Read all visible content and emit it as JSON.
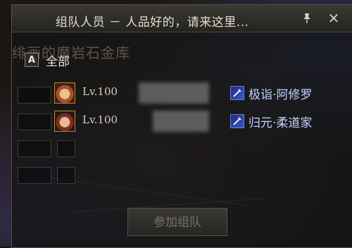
{
  "window": {
    "title": "组队人员 － 人品好的，请来这里..."
  },
  "background_text": "绯画的魔岩石金库",
  "filter": {
    "label": "全部",
    "icon_glyph": "A"
  },
  "members": [
    {
      "level": "Lv.100",
      "class_name": "极诣·阿修罗",
      "avatar_icon": "character-portrait-icon"
    },
    {
      "level": "Lv.100",
      "class_name": "归元·柔道家",
      "avatar_icon": "character-portrait-icon"
    }
  ],
  "join_button": {
    "label": "参加组队",
    "enabled": false
  },
  "icons": {
    "pin": "pin-icon",
    "close": "close-icon",
    "class": "sword-icon"
  },
  "colors": {
    "class_text": "#c5d2ff",
    "accent_border": "#b48b46"
  }
}
